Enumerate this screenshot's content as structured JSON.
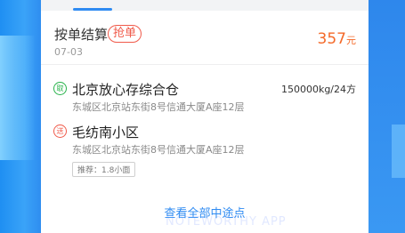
{
  "order": {
    "settle_type": "按单结算",
    "grab_badge": "抢单",
    "date": "07-03",
    "price": "357",
    "price_unit": "元"
  },
  "pickup": {
    "icon_label": "取",
    "name": "北京放心存综合仓",
    "address": "东城区北京站东街8号信通大厦A座12层",
    "cargo": "150000kg/24方"
  },
  "dropoff": {
    "icon_label": "送",
    "name": "毛纺南小区",
    "address": "东城区北京站东街8号信通大厦A座12层",
    "vehicle_tag": "推荐：1.8小面"
  },
  "view_all_label": "查看全部中途点",
  "watermark": "NOTEWORTHY APP",
  "colors": {
    "accent": "#2f8bf2",
    "price": "#f46a2a",
    "grab": "#f05a4a",
    "pickup": "#27b24a",
    "dropoff": "#f05a4a"
  }
}
